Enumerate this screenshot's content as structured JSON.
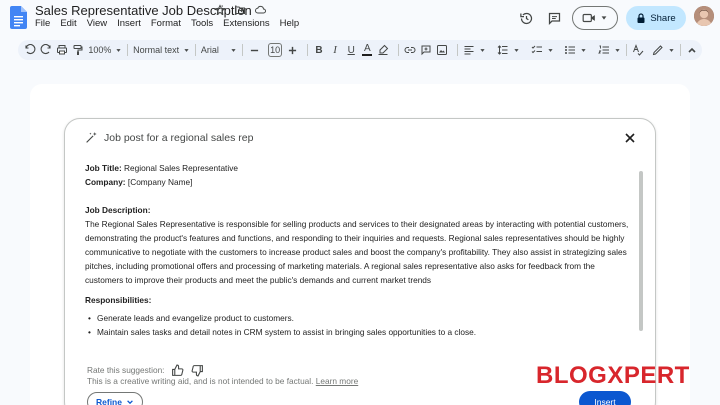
{
  "app": {
    "title": "Sales Representative Job Description",
    "menu": [
      "File",
      "Edit",
      "View",
      "Insert",
      "Format",
      "Tools",
      "Extensions",
      "Help"
    ],
    "share_label": "Share"
  },
  "toolbar": {
    "zoom": "100%",
    "style": "Normal text",
    "font": "Arial",
    "font_size": "10",
    "bold_label": "B",
    "italic_label": "I",
    "underline_label": "U",
    "color_label": "A"
  },
  "dialog": {
    "prompt": "Job post for a regional sales rep",
    "job_title_label": "Job Title:",
    "job_title_value": "Regional Sales Representative",
    "company_label": "Company:",
    "company_value": "[Company Name]",
    "description_heading": "Job Description:",
    "description_text": "The Regional Sales Representative is responsible for selling products and services to their designated areas by interacting with potential customers, demonstrating the product's features and functions, and responding to their inquiries and requests. Regional sales representatives should be highly communicative to negotiate with the customers to increase product sales and boost the company's profitability. They also assist in strategizing sales pitches, including promotional offers and processing of marketing materials. A regional sales representative also asks for feedback from the customers to improve their products and meet the public's demands and current market trends",
    "responsibilities_heading": "Responsibilities:",
    "responsibilities": [
      "Generate leads and evangelize product to customers.",
      "Maintain sales tasks and detail notes in CRM system to assist in bringing sales opportunities to a close."
    ],
    "rate_label": "Rate this suggestion:",
    "disclaimer_text": "This is a creative writing aid, and is not intended to be factual.",
    "learn_more": "Learn more",
    "refine_label": "Refine",
    "insert_label": "Insert"
  },
  "watermark": "BLOGXPERT",
  "colors": {
    "accent": "#0b57d0",
    "share_bg": "#c2e7ff",
    "toolbar_bg": "#edf2fa",
    "docs_blue": "#4285f4",
    "watermark": "#d8262c"
  }
}
